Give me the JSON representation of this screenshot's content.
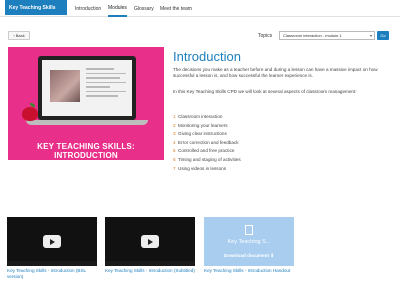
{
  "nav": {
    "brand": "Key Teaching Skills",
    "tabs": [
      {
        "label": "Introduction"
      },
      {
        "label": "Modules"
      },
      {
        "label": "Glossary"
      },
      {
        "label": "Meet the team"
      }
    ],
    "active_tab": "Modules"
  },
  "toolbar": {
    "back_label": "Back",
    "topics_label": "Topics",
    "topics_selected": "Classroom interaction - module 1",
    "go_label": "Go"
  },
  "hero": {
    "caption": "KEY TEACHING SKILLS: INTRODUCTION"
  },
  "intro": {
    "title": "Introduction",
    "paragraph1": "The decisions you make as a teacher before and during a lesson can have a massive impact on how successful a lesson is, and how successful the learner experience is.",
    "paragraph2": "In this Key Teaching Skills CPD we will look at several aspects of classroom management:",
    "topics": [
      {
        "num": "1",
        "label": "Classroom interaction"
      },
      {
        "num": "2",
        "label": "Monitoring your learners"
      },
      {
        "num": "3",
        "label": "Giving clear instructions"
      },
      {
        "num": "4",
        "label": "Error correction and feedback"
      },
      {
        "num": "5",
        "label": "Controlled and free practice"
      },
      {
        "num": "6",
        "label": "Timing and staging of activities"
      },
      {
        "num": "7",
        "label": "Using videos in lessons"
      }
    ]
  },
  "resources": [
    {
      "caption": "Key Teaching Skills - Introduction (BSL version)",
      "type": "video"
    },
    {
      "caption": "Key Teaching Skills - Introduction (Subtitled)",
      "type": "video"
    },
    {
      "caption": "Key Teaching Skills - Introduction Handout",
      "type": "document",
      "card_title": "Key Teaching S...",
      "download_label": "Download document"
    }
  ],
  "colors": {
    "accent": "#1d7fbd",
    "hero_bg": "#e8308a",
    "number": "#e07b22",
    "doc_card": "#a8cdee"
  }
}
